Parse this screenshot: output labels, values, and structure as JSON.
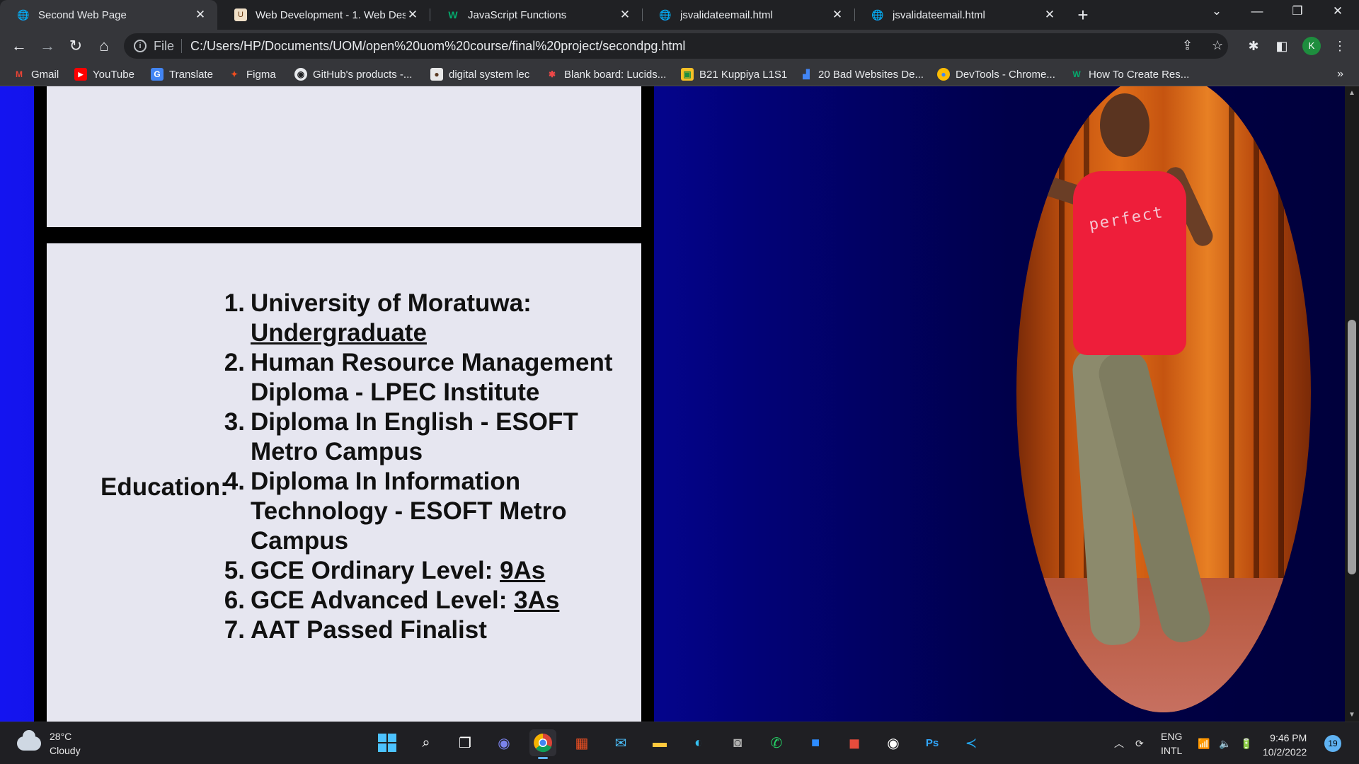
{
  "browser": {
    "tabs": [
      {
        "title": "Second Web Page",
        "icon": "globe-icon",
        "active": true
      },
      {
        "title": "Web Development - 1. Web Desi",
        "icon": "udemy-icon",
        "active": false
      },
      {
        "title": "JavaScript Functions",
        "icon": "w3schools-icon",
        "active": false
      },
      {
        "title": "jsvalidateemail.html",
        "icon": "globe-icon",
        "active": false
      },
      {
        "title": "jsvalidateemail.html",
        "icon": "globe-icon",
        "active": false
      }
    ],
    "new_tab": "+",
    "address": {
      "scheme_label": "File",
      "url": "C:/Users/HP/Documents/UOM/open%20uom%20course/final%20project/secondpg.html"
    },
    "profile_initial": "K",
    "bookmarks": [
      {
        "label": "Gmail",
        "icon": "gmail-icon"
      },
      {
        "label": "YouTube",
        "icon": "youtube-icon"
      },
      {
        "label": "Translate",
        "icon": "translate-icon"
      },
      {
        "label": "Figma",
        "icon": "figma-icon"
      },
      {
        "label": "GitHub's products -...",
        "icon": "github-icon"
      },
      {
        "label": "digital system lec",
        "icon": "person-icon"
      },
      {
        "label": "Blank board: Lucids...",
        "icon": "lucid-icon"
      },
      {
        "label": "B21 Kuppiya L1S1",
        "icon": "classroom-icon"
      },
      {
        "label": "20 Bad Websites De...",
        "icon": "chart-icon"
      },
      {
        "label": "DevTools - Chrome...",
        "icon": "chrome-icon"
      },
      {
        "label": "How To Create Res...",
        "icon": "w3schools-icon"
      }
    ],
    "bookmarks_more": "»"
  },
  "page": {
    "education": {
      "label": "Education:",
      "items": [
        {
          "num": "1.",
          "text": "University of Moratuwa: ",
          "underlined": "Undergraduate"
        },
        {
          "num": "2.",
          "text": "Human Resource Management Diploma - LPEC Institute",
          "underlined": ""
        },
        {
          "num": "3.",
          "text": "Diploma In English - ESOFT Metro Campus",
          "underlined": ""
        },
        {
          "num": "4.",
          "text": "Diploma In Information Technology - ESOFT Metro Campus",
          "underlined": ""
        },
        {
          "num": "5.",
          "text": "GCE Ordinary Level: ",
          "underlined": "9As"
        },
        {
          "num": "6.",
          "text": "GCE Advanced Level: ",
          "underlined": "3As"
        },
        {
          "num": "7.",
          "text": "AAT Passed Finalist",
          "underlined": ""
        }
      ]
    },
    "photo": {
      "shirt_text": "perfect"
    }
  },
  "taskbar": {
    "weather": {
      "temp": "28°C",
      "condition": "Cloudy"
    },
    "language": {
      "line1": "ENG",
      "line2": "INTL"
    },
    "clock": {
      "time": "9:46 PM",
      "date": "10/2/2022"
    },
    "notifications": "19"
  }
}
